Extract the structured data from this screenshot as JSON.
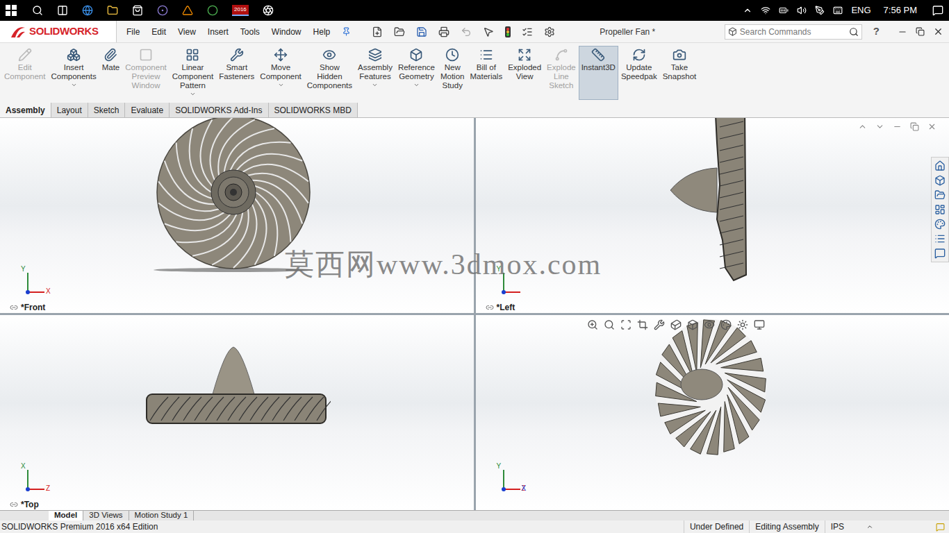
{
  "taskbar": {
    "language": "ENG",
    "time": "7:56 PM",
    "app_badge": "2016"
  },
  "app": {
    "logo": "SOLIDWORKS",
    "menu": [
      "File",
      "Edit",
      "View",
      "Insert",
      "Tools",
      "Window",
      "Help"
    ],
    "document_title": "Propeller Fan *",
    "search": {
      "placeholder": "Search Commands"
    },
    "help": "?"
  },
  "ribbon": [
    {
      "lines": [
        "Edit",
        "Component"
      ],
      "disabled": true,
      "selected": false,
      "dropdown": false
    },
    {
      "lines": [
        "Insert",
        "Components"
      ],
      "disabled": false,
      "selected": false,
      "dropdown": true
    },
    {
      "lines": [
        "Mate"
      ],
      "disabled": false,
      "selected": false,
      "dropdown": false
    },
    {
      "lines": [
        "Component",
        "Preview",
        "Window"
      ],
      "disabled": true,
      "selected": false,
      "dropdown": false
    },
    {
      "lines": [
        "Linear",
        "Component",
        "Pattern"
      ],
      "disabled": false,
      "selected": false,
      "dropdown": true
    },
    {
      "lines": [
        "Smart",
        "Fasteners"
      ],
      "disabled": false,
      "selected": false,
      "dropdown": false
    },
    {
      "lines": [
        "Move",
        "Component"
      ],
      "disabled": false,
      "selected": false,
      "dropdown": true
    },
    {
      "lines": [
        "Show",
        "Hidden",
        "Components"
      ],
      "disabled": false,
      "selected": false,
      "dropdown": false
    },
    {
      "lines": [
        "Assembly",
        "Features"
      ],
      "disabled": false,
      "selected": false,
      "dropdown": true
    },
    {
      "lines": [
        "Reference",
        "Geometry"
      ],
      "disabled": false,
      "selected": false,
      "dropdown": true
    },
    {
      "lines": [
        "New",
        "Motion",
        "Study"
      ],
      "disabled": false,
      "selected": false,
      "dropdown": false
    },
    {
      "lines": [
        "Bill of",
        "Materials"
      ],
      "disabled": false,
      "selected": false,
      "dropdown": false
    },
    {
      "lines": [
        "Exploded",
        "View"
      ],
      "disabled": false,
      "selected": false,
      "dropdown": false
    },
    {
      "lines": [
        "Explode",
        "Line",
        "Sketch"
      ],
      "disabled": true,
      "selected": false,
      "dropdown": false
    },
    {
      "lines": [
        "Instant3D"
      ],
      "disabled": false,
      "selected": true,
      "dropdown": false
    },
    {
      "lines": [
        "Update",
        "Speedpak"
      ],
      "disabled": false,
      "selected": false,
      "dropdown": false
    },
    {
      "lines": [
        "Take",
        "Snapshot"
      ],
      "disabled": false,
      "selected": false,
      "dropdown": false
    }
  ],
  "tabs": [
    {
      "label": "Assembly",
      "selected": true
    },
    {
      "label": "Layout",
      "selected": false
    },
    {
      "label": "Sketch",
      "selected": false
    },
    {
      "label": "Evaluate",
      "selected": false
    },
    {
      "label": "SOLIDWORKS Add-Ins",
      "selected": false
    },
    {
      "label": "SOLIDWORKS MBD",
      "selected": false
    }
  ],
  "viewports": [
    {
      "label": "*Front",
      "kind": "front",
      "axes": [
        "Y",
        "X"
      ]
    },
    {
      "label": "*Left",
      "kind": "left",
      "axes": [
        "Y"
      ]
    },
    {
      "label": "*Top",
      "kind": "top",
      "axes": [
        "X",
        "Z"
      ]
    },
    {
      "label": "",
      "kind": "iso",
      "axes": [
        "Y",
        "Z",
        "X"
      ]
    }
  ],
  "watermark": "莫西网www.3dmox.com",
  "bottom_tabs": [
    {
      "label": "Model",
      "selected": true
    },
    {
      "label": "3D Views",
      "selected": false
    },
    {
      "label": "Motion Study 1",
      "selected": false
    }
  ],
  "status_bar": {
    "edition": "SOLIDWORKS Premium 2016 x64 Edition",
    "items": [
      "Under Defined",
      "Editing Assembly",
      "IPS"
    ]
  }
}
